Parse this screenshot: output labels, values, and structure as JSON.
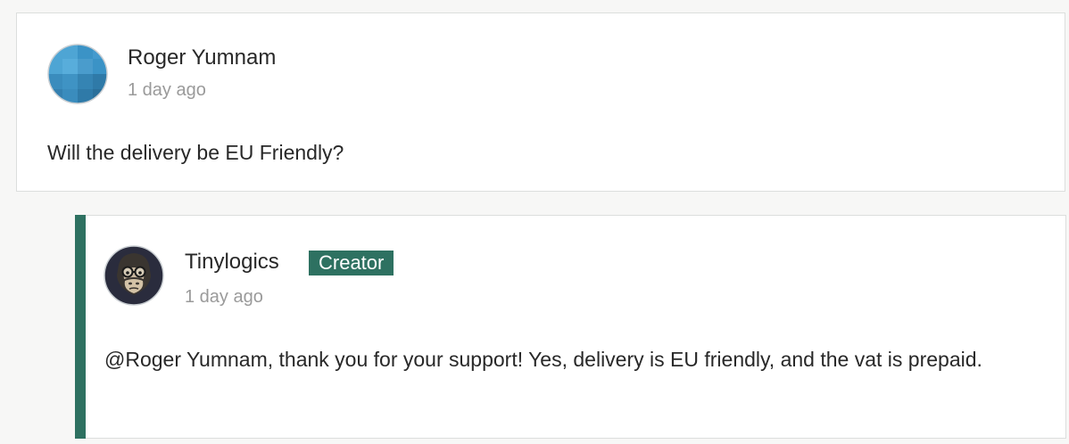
{
  "comment": {
    "author": "Roger Yumnam",
    "timestamp": "1 day ago",
    "body": "Will the delivery be EU Friendly?",
    "avatar_icon": "geometric-blue-avatar-icon"
  },
  "reply": {
    "author": "Tinylogics",
    "badge": "Creator",
    "timestamp": "1 day ago",
    "body": "@Roger Yumnam, thank you for your support! Yes, delivery is EU friendly, and the vat is prepaid.",
    "avatar_icon": "gorilla-with-glasses-avatar-icon"
  },
  "colors": {
    "accent": "#2e7161",
    "badge_bg": "#2e7161",
    "muted_text": "#9a9a9a"
  }
}
